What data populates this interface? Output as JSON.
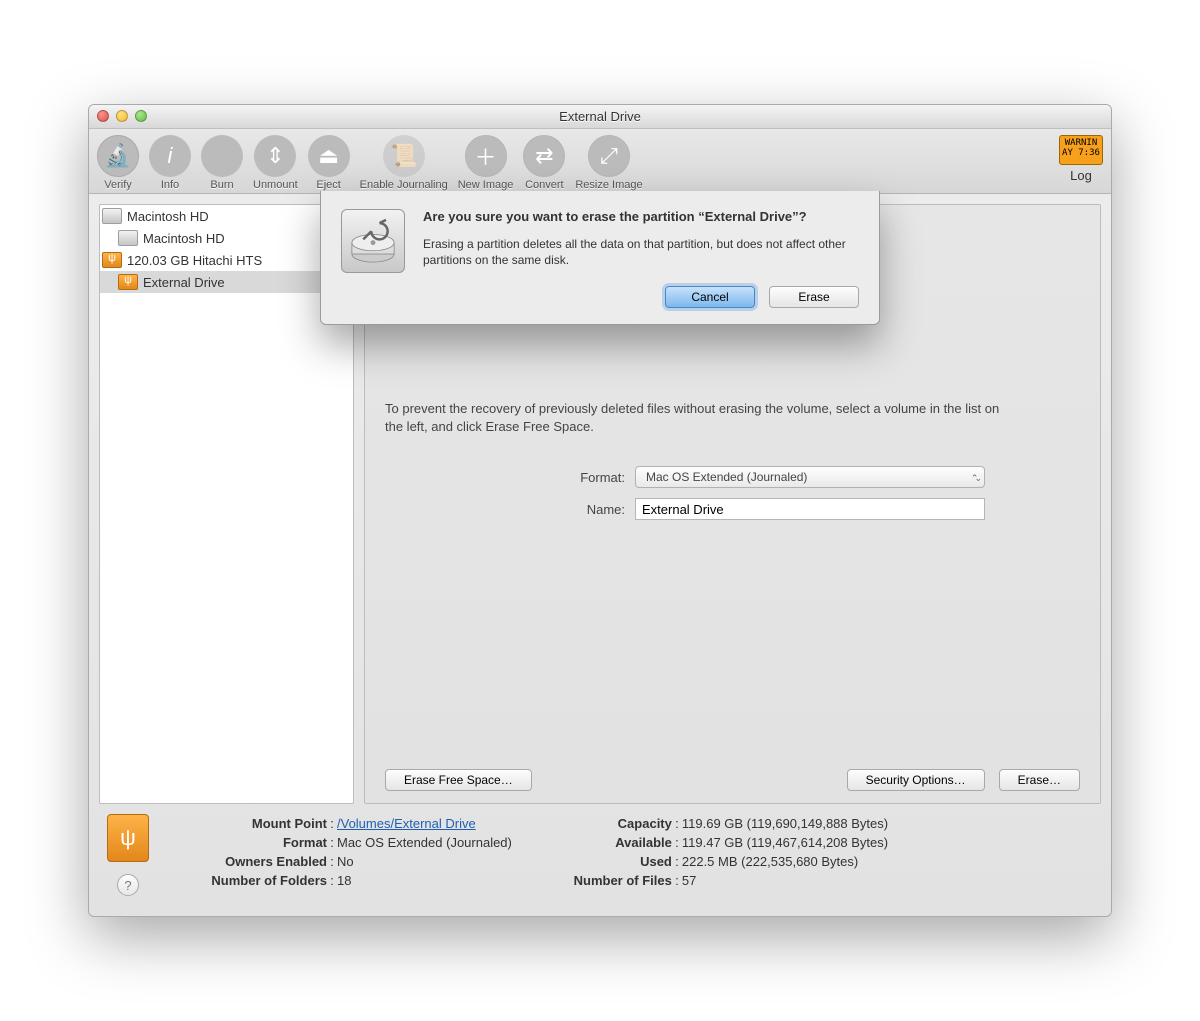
{
  "window": {
    "title": "External Drive"
  },
  "toolbar": {
    "verify": "Verify",
    "info": "Info",
    "burn": "Burn",
    "unmount": "Unmount",
    "eject": "Eject",
    "journal": "Enable Journaling",
    "newimage": "New Image",
    "convert": "Convert",
    "resize": "Resize Image",
    "log": "Log",
    "log_badge_line1": "WARNIN",
    "log_badge_line2": "AY 7:36"
  },
  "sidebar": {
    "items": [
      {
        "label": "Macintosh HD",
        "kind": "internal",
        "indent": 0
      },
      {
        "label": "Macintosh HD",
        "kind": "internal",
        "indent": 1
      },
      {
        "label": "120.03 GB Hitachi HTS",
        "kind": "usb",
        "indent": 0
      },
      {
        "label": "External Drive",
        "kind": "usb",
        "indent": 1,
        "selected": true
      }
    ]
  },
  "main": {
    "blurb": "To prevent the recovery of previously deleted files without erasing the volume, select a volume in the list on the left, and click Erase Free Space.",
    "format_label": "Format:",
    "format_value": "Mac OS Extended (Journaled)",
    "name_label": "Name:",
    "name_value": "External Drive",
    "erase_free_space": "Erase Free Space…",
    "security_options": "Security Options…",
    "erase": "Erase…"
  },
  "dialog": {
    "title": "Are you sure you want to erase the partition “External Drive”?",
    "body": "Erasing a partition deletes all the data on that partition, but does not affect other partitions on the same disk.",
    "cancel": "Cancel",
    "confirm": "Erase"
  },
  "footer": {
    "mount_point_k": "Mount Point",
    "mount_point_v": "/Volumes/External Drive",
    "format_k": "Format",
    "format_v": "Mac OS Extended (Journaled)",
    "owners_k": "Owners Enabled",
    "owners_v": "No",
    "folders_k": "Number of Folders",
    "folders_v": "18",
    "capacity_k": "Capacity",
    "capacity_v": "119.69 GB (119,690,149,888 Bytes)",
    "available_k": "Available",
    "available_v": "119.47 GB (119,467,614,208 Bytes)",
    "used_k": "Used",
    "used_v": "222.5 MB (222,535,680 Bytes)",
    "files_k": "Number of Files",
    "files_v": "57"
  }
}
